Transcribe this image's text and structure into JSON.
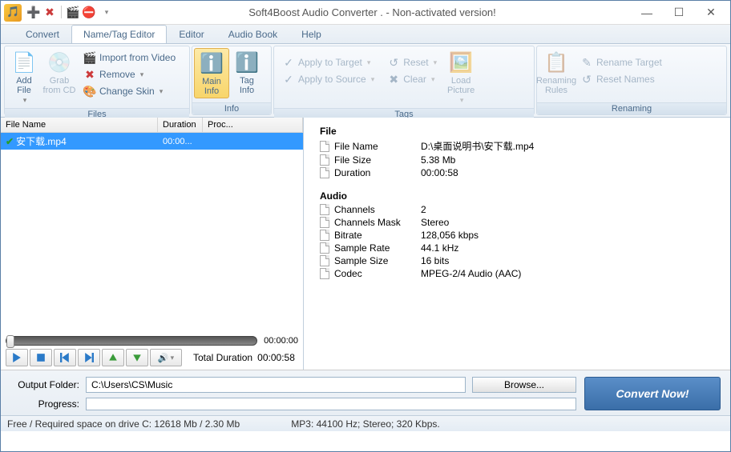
{
  "title": "Soft4Boost Audio Converter  . - Non-activated version!",
  "tabs": {
    "convert": "Convert",
    "nametag": "Name/Tag Editor",
    "editor": "Editor",
    "audiobook": "Audio Book",
    "help": "Help"
  },
  "ribbon": {
    "files": {
      "label": "Files",
      "add": "Add\nFile",
      "grab": "Grab\nfrom CD",
      "import": "Import from Video",
      "remove": "Remove",
      "skin": "Change Skin"
    },
    "info": {
      "label": "Info",
      "main": "Main\nInfo",
      "tag": "Tag\nInfo"
    },
    "tags": {
      "label": "Tags",
      "apply_target": "Apply to Target",
      "apply_source": "Apply to Source",
      "reset": "Reset",
      "clear": "Clear",
      "load_picture": "Load\nPicture"
    },
    "renaming": {
      "label": "Renaming",
      "rules": "Renaming\nRules",
      "rename_target": "Rename Target",
      "reset_names": "Reset Names"
    }
  },
  "filelist": {
    "cols": {
      "name": "File Name",
      "duration": "Duration",
      "proc": "Proc..."
    },
    "rows": [
      {
        "name": "安下载.mp4",
        "duration": "00:00..."
      }
    ]
  },
  "playback": {
    "position": "00:00:00",
    "total_label": "Total Duration",
    "total": "00:00:58"
  },
  "info": {
    "file_section": "File",
    "audio_section": "Audio",
    "fields": {
      "filename": {
        "label": "File Name",
        "value": "D:\\桌面说明书\\安下载.mp4"
      },
      "filesize": {
        "label": "File Size",
        "value": "5.38 Mb"
      },
      "duration": {
        "label": "Duration",
        "value": "00:00:58"
      },
      "channels": {
        "label": "Channels",
        "value": "2"
      },
      "channels_mask": {
        "label": "Channels Mask",
        "value": "Stereo"
      },
      "bitrate": {
        "label": "Bitrate",
        "value": "128,056 kbps"
      },
      "sample_rate": {
        "label": "Sample Rate",
        "value": "44.1 kHz"
      },
      "sample_size": {
        "label": "Sample Size",
        "value": "16 bits"
      },
      "codec": {
        "label": "Codec",
        "value": "MPEG-2/4 Audio (AAC)"
      }
    }
  },
  "bottom": {
    "output_label": "Output Folder:",
    "output_value": "C:\\Users\\CS\\Music",
    "browse": "Browse...",
    "progress_label": "Progress:",
    "convert": "Convert Now!"
  },
  "status": {
    "left": "Free / Required space on drive  C: 12618 Mb / 2.30 Mb",
    "mid": "MP3: 44100  Hz; Stereo; 320 Kbps."
  }
}
